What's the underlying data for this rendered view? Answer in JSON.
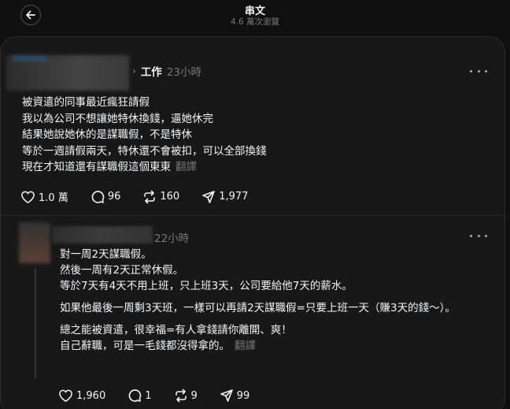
{
  "header": {
    "title": "串文",
    "subtitle": "4.6 萬次瀏覽",
    "back_icon": "arrow-left-icon"
  },
  "post": {
    "topic": "工作",
    "time": "23小時",
    "lines": [
      "被資遣的同事最近瘋狂請假",
      "我以為公司不想讓她特休換錢，逼她休完",
      "結果她說她休的是謀職假，不是特休",
      "等於一週請假兩天，特休還不會被扣，可以全部換錢",
      "現在才知道還有謀職假這個東東"
    ],
    "translate_label": "翻譯",
    "stats": {
      "likes": "1.0 萬",
      "comments": "96",
      "reposts": "160",
      "shares": "1,977"
    }
  },
  "reply": {
    "time": "22小時",
    "paragraphs": [
      [
        "對一周2天謀職假。",
        "然後一周有2天正常休假。",
        "等於7天有4天不用上班，只上班3天，公司要給他7天的薪水。"
      ],
      [
        "如果他最後一周剩3天班，一樣可以再請2天謀職假=只要上班一天（賺3天的錢～）。"
      ],
      [
        "總之能被資遣，很幸福=有人拿錢請你離開、爽！",
        "自己辭職，可是一毛錢都沒得拿的。"
      ]
    ],
    "translate_label": "翻譯",
    "stats": {
      "likes": "1,960",
      "comments": "1",
      "reposts": "9",
      "shares": "99"
    }
  }
}
